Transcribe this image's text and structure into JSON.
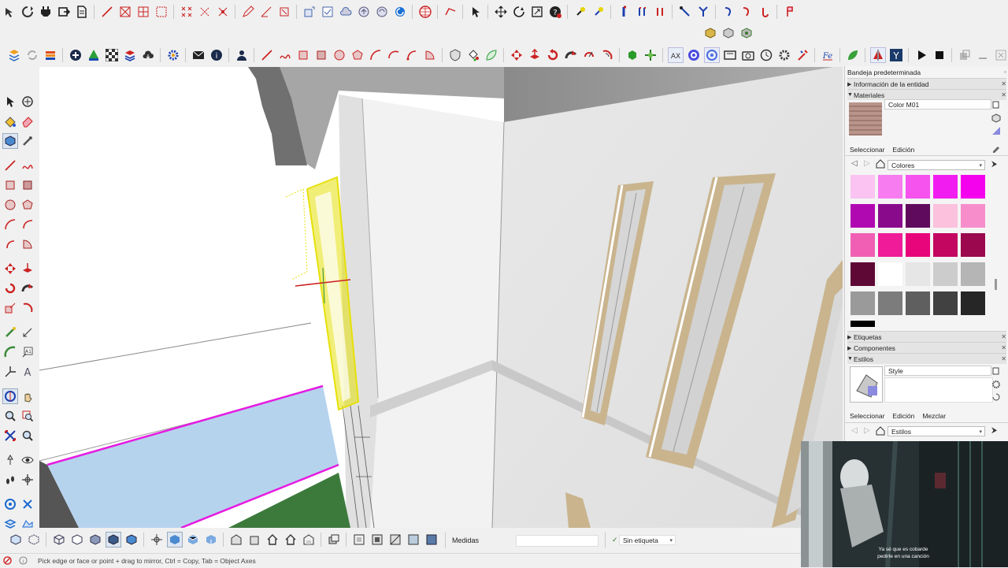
{
  "right_panel": {
    "tray_title": "Bandeja predeterminada",
    "entity_info": "Información de la entidad",
    "materials": {
      "header": "Materiales",
      "material_name": "Color M01",
      "tab_select": "Seleccionar",
      "tab_edit": "Edición",
      "collection": "Colores",
      "swatches": [
        "#fbc3f2",
        "#f77cf0",
        "#f552ee",
        "#f11df0",
        "#f402ee",
        "#b109b2",
        "#8a0a8c",
        "#5f0a5c",
        "#fbc1dd",
        "#f78ecb",
        "#f15fb4",
        "#ef1b99",
        "#e8047a",
        "#c3065f",
        "#9b084d",
        "#5e0835",
        "#ffffff",
        "#e6e6e6",
        "#cccccc",
        "#b5b5b5",
        "#9a9a9a",
        "#7c7c7c",
        "#5f5f5f",
        "#414141",
        "#262626",
        "#000000"
      ]
    },
    "tags": "Etiquetas",
    "components": "Componentes",
    "styles": {
      "header": "Estilos",
      "style_name": "Style",
      "tab_select": "Seleccionar",
      "tab_edit": "Edición",
      "tab_mix": "Mezclar",
      "collection": "Estilos"
    }
  },
  "bottom": {
    "measure_label": "Medidas",
    "tag_value": "Sin etiqueta"
  },
  "status": {
    "hint": "Pick edge or face or point + drag to mirror, Ctrl = Copy, Tab = Object Axes"
  },
  "video": {
    "subtitle_line1": "Ya sé que es cobarde",
    "subtitle_line2": "pedirte en una canción"
  },
  "colors": {
    "selection": "#e6e00a",
    "wall": "#e4e4e4",
    "frame": "#c9b48e",
    "glass": "#b6d3ee",
    "magenta": "#e51be0"
  }
}
